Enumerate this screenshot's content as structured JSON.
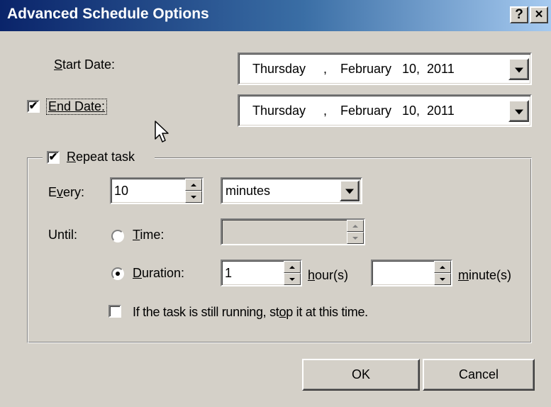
{
  "window": {
    "title": "Advanced Schedule Options",
    "help_button": "?",
    "close_button": "×"
  },
  "start_date": {
    "label_mnemonic": "S",
    "label_rest": "tart Date:",
    "weekday": "Thursday",
    "sep": ",",
    "month": "February",
    "day": "10,",
    "year": "2011"
  },
  "end_date": {
    "checked": true,
    "check_glyph": "✔",
    "label_mnemonic": "E",
    "label_rest": "nd Date:",
    "weekday": "Thursday",
    "sep": ",",
    "month": "February",
    "day": "10,",
    "year": "2011"
  },
  "repeat": {
    "checked": true,
    "check_glyph": "✔",
    "label_mnemonic": "R",
    "label_rest": "epeat task",
    "every_label_pre": "E",
    "every_label_mnemonic": "v",
    "every_label_post": "ery:",
    "every_value": "10",
    "unit_value": "minutes",
    "until_label": "Until:",
    "time_label_mnemonic": "T",
    "time_label_rest": "ime:",
    "time_selected": false,
    "time_value": "",
    "duration_label_mnemonic": "D",
    "duration_label_rest": "uration:",
    "duration_selected": true,
    "duration_hours_value": "1",
    "hours_label_mnemonic": "h",
    "hours_label_rest": "our(s)",
    "duration_minutes_value": "",
    "minutes_label_mnemonic": "m",
    "minutes_label_rest": "inute(s)",
    "stop_checked": false,
    "stop_label_pre": "If the task is still running, st",
    "stop_label_mnemonic": "o",
    "stop_label_post": "p it at this time."
  },
  "buttons": {
    "ok": "OK",
    "cancel": "Cancel"
  },
  "colors": {
    "titlebar_start": "#0a246a",
    "titlebar_end": "#a6caf0",
    "face": "#d4d0c8"
  }
}
